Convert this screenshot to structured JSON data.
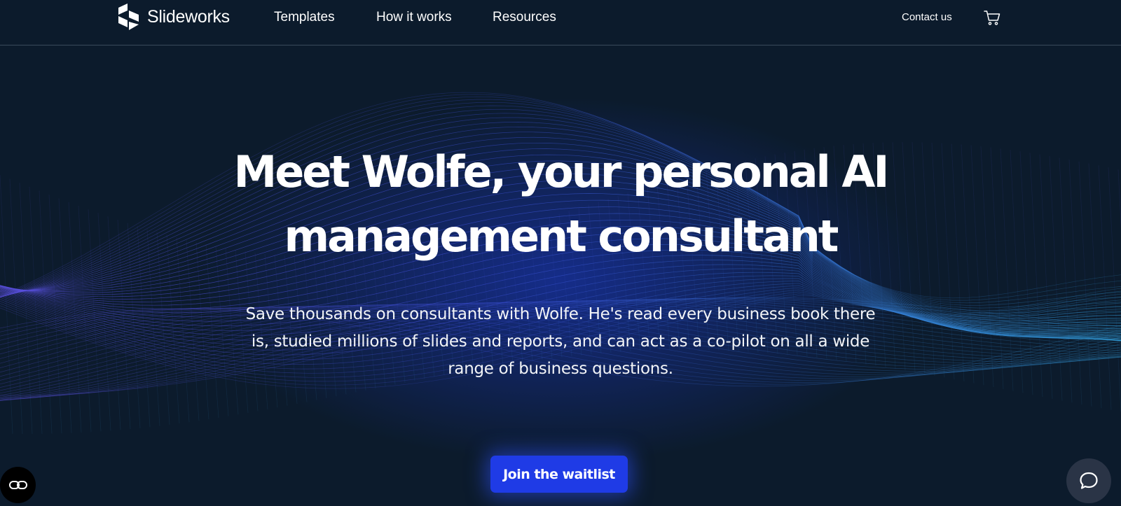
{
  "header": {
    "brand": "Slideworks",
    "nav": {
      "templates": "Templates",
      "how_it_works": "How it works",
      "resources": "Resources"
    },
    "contact": "Contact us",
    "cart_icon": "shopping-cart-icon"
  },
  "hero": {
    "title": "Meet Wolfe, your personal AI management consultant",
    "subtitle": "Save thousands on consultants with Wolfe. He's read every business book there is, studied millions of slides and reports, and can act as a co-pilot on all a wide range of business questions.",
    "cta": "Join the waitlist"
  },
  "floating": {
    "left_icon": "link-icon",
    "right_icon": "chat-bubble-icon"
  },
  "colors": {
    "background": "#0c1b2c",
    "cta": "#1f3be6",
    "wave_left": "#4f4fd6",
    "wave_right": "#2f8fcf"
  }
}
